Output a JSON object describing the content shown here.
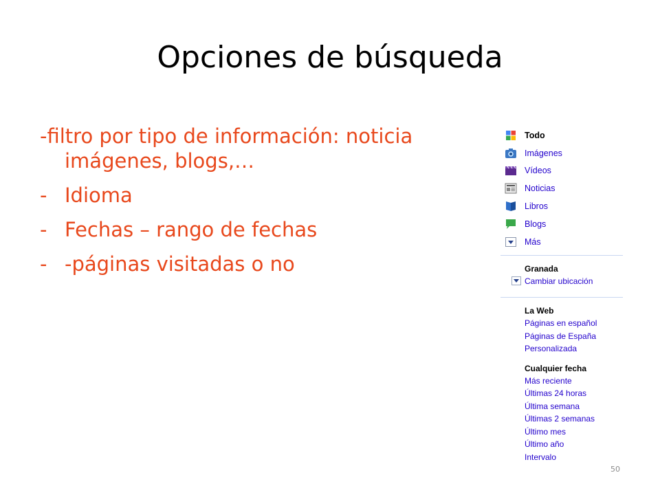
{
  "slide": {
    "title": "Opciones de búsqueda",
    "lead_bullet": "-filtro por tipo de información: noticia imágenes, blogs,…",
    "bullets": [
      "Idioma",
      "Fechas – rango de fechas",
      "-páginas visitadas o no"
    ],
    "page_number": "50"
  },
  "panel": {
    "types": [
      {
        "label": "Todo",
        "icon": "google-logo-icon",
        "active": true
      },
      {
        "label": "Imágenes",
        "icon": "camera-icon",
        "active": false
      },
      {
        "label": "Vídeos",
        "icon": "film-icon",
        "active": false
      },
      {
        "label": "Noticias",
        "icon": "newspaper-icon",
        "active": false
      },
      {
        "label": "Libros",
        "icon": "book-icon",
        "active": false
      },
      {
        "label": "Blogs",
        "icon": "speech-bubble-icon",
        "active": false
      },
      {
        "label": "Más",
        "icon": "dropdown-arrow-icon",
        "active": false
      }
    ],
    "location": {
      "heading": "Granada",
      "change": "Cambiar ubicación"
    },
    "web": {
      "heading": "La Web",
      "options": [
        "Páginas en español",
        "Páginas de España",
        "Personalizada"
      ]
    },
    "date": {
      "heading": "Cualquier fecha",
      "options": [
        "Más reciente",
        "Últimas 24 horas",
        "Última semana",
        "Últimas 2 semanas",
        "Último mes",
        "Último año",
        "Intervalo"
      ]
    }
  },
  "colors": {
    "accent_text": "#e8481c",
    "link": "#2200cc"
  }
}
